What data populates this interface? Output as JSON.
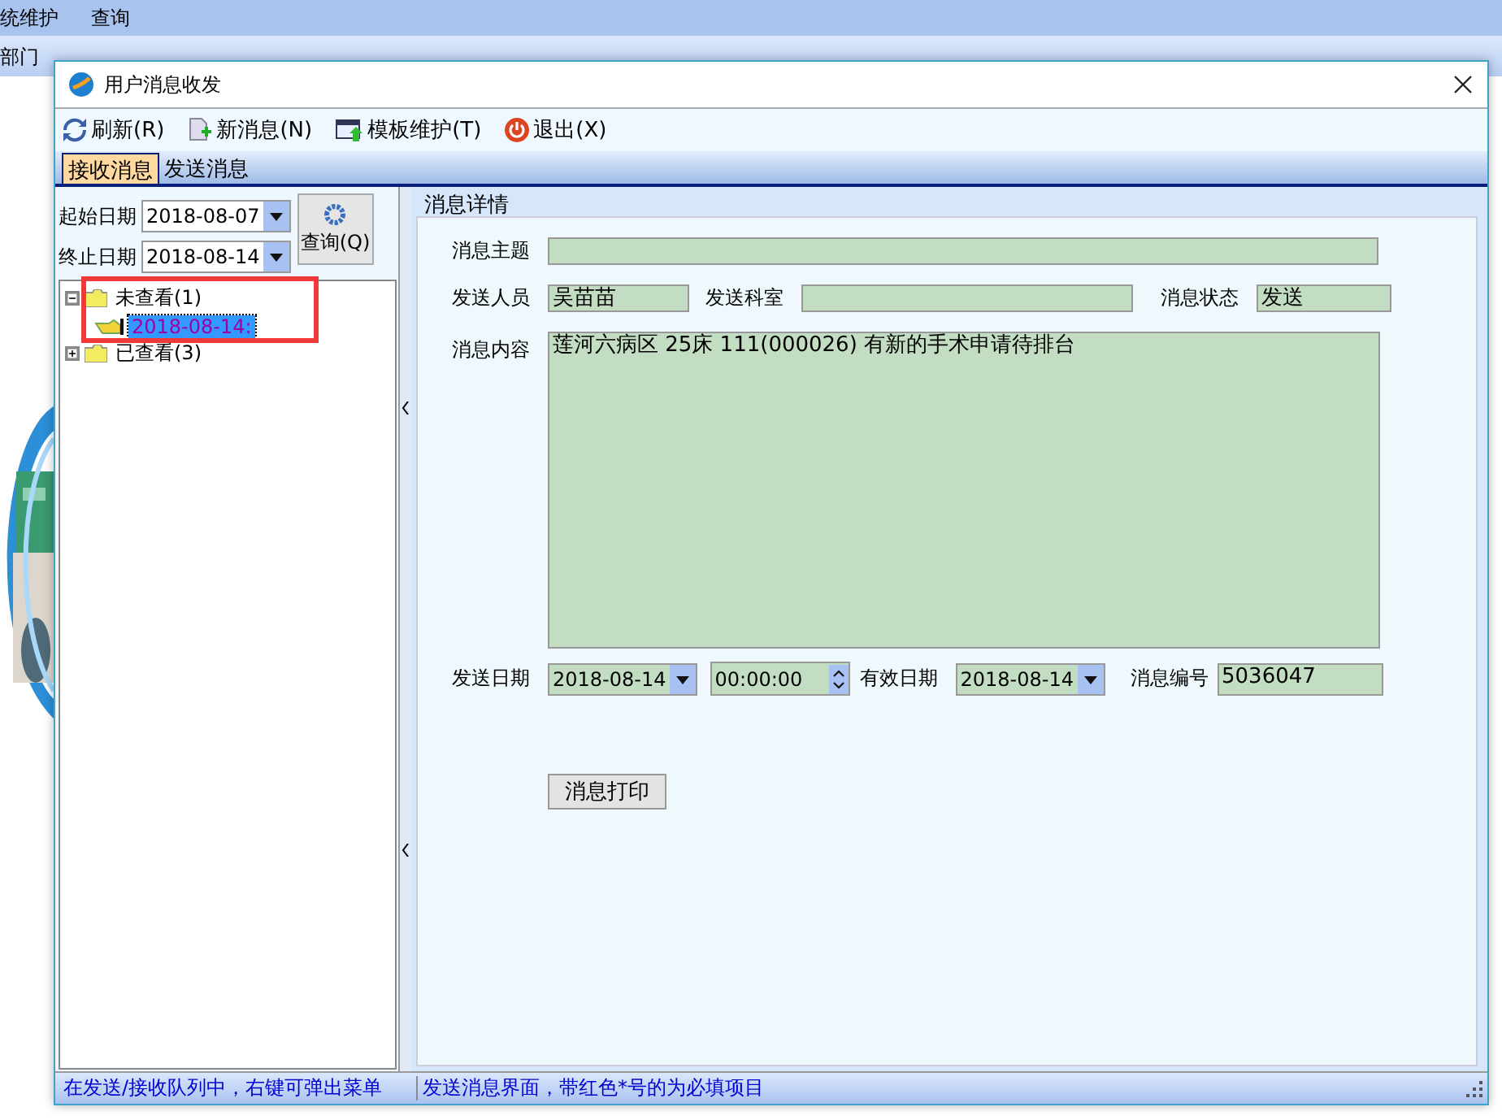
{
  "background_app": {
    "menu": [
      "统维护",
      "查询"
    ],
    "toolbar_label": "部门"
  },
  "window": {
    "title": "用户消息收发"
  },
  "toolbar": [
    {
      "kind": "refresh",
      "label": "刷新(R)"
    },
    {
      "kind": "new",
      "label": "新消息(N)"
    },
    {
      "kind": "template",
      "label": "模板维护(T)"
    },
    {
      "kind": "exit",
      "label": "退出(X)"
    }
  ],
  "tabs": [
    {
      "label": "接收消息",
      "selected": true
    },
    {
      "label": "发送消息",
      "selected": false
    }
  ],
  "filter": {
    "start": {
      "label": "起始日期",
      "value": "2018-08-07"
    },
    "end": {
      "label": "终止日期",
      "value": "2018-08-14"
    },
    "query_button": "查询(Q)"
  },
  "tree": [
    {
      "label": "未查看(1)",
      "expanded": true,
      "selected": false,
      "children": [
        {
          "label": "2018-08-14:",
          "selected": true
        }
      ]
    },
    {
      "label": "已查看(3)",
      "expanded": false,
      "selected": false
    }
  ],
  "detail": {
    "title": "消息详情",
    "subject": {
      "label": "消息主题"
    },
    "sender": {
      "label": "发送人员",
      "value": "吴苗苗"
    },
    "department": {
      "label": "发送科室"
    },
    "status": {
      "label": "消息状态",
      "value": "发送"
    },
    "content": {
      "label": "消息内容",
      "value": "莲河六病区 25床 111(000026) 有新的手术申请待排台"
    },
    "send_date": {
      "label": "发送日期",
      "value": "2018-08-14"
    },
    "send_time": {
      "value": "00:00:00"
    },
    "valid_date": {
      "label": "有效日期",
      "value": "2018-08-14"
    },
    "number": {
      "label": "消息编号",
      "value": "5036047"
    },
    "print_button": "消息打印"
  },
  "status_bar": [
    "在发送/接收队列中，右键可弹出菜单",
    "发送消息界面，带红色*号的为必填项目"
  ]
}
